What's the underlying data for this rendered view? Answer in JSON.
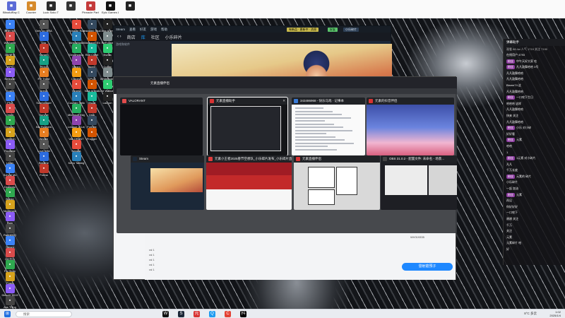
{
  "desktop": {
    "top_row": [
      {
        "label": "BlissfulRay Center",
        "icon": "app-icon",
        "color": "#5b6bd6"
      },
      {
        "label": "Counter",
        "icon": "app-icon",
        "color": "#d68a2b"
      },
      {
        "label": "Luck Soko T",
        "icon": "app-icon",
        "color": "#2b2b2b"
      },
      {
        "label": "",
        "icon": "app-icon",
        "color": "#333"
      },
      {
        "label": "Pinnacle Party",
        "icon": "app-icon",
        "color": "#c43a3a"
      },
      {
        "label": "Epic Games Launcher",
        "icon": "app-icon",
        "color": "#111"
      },
      {
        "label": "",
        "icon": "app-icon",
        "color": "#222"
      }
    ],
    "col1": [
      "腾讯TIM",
      "WeGame",
      "360安全",
      "WPS",
      "Netease",
      "Guard",
      "PN2",
      "Origin",
      "Dragon",
      "Logitech",
      "Rockstar",
      "Uplay",
      "School Mx",
      "Dragonlz",
      "Bunke",
      "Nightmare",
      "Ruin",
      "RabbitMQ",
      "Steam",
      "QQ音乐",
      "Pal Story",
      "Flash",
      "DirectX 2019",
      "Ass Thing"
    ],
    "col2": [
      "Only Up BRAINR",
      "Dig",
      "Sorgen",
      "PEAK",
      "RV There",
      "Arena",
      "Schrödinger",
      "Survive",
      "Bio Rushers",
      "Wordle",
      "Love Wild",
      "Breathe",
      "Forma"
    ],
    "col3": [
      "Pinnacle Rocket",
      "BenchMark",
      "Geophysics",
      "Steam",
      "Chrome",
      "Vegeta",
      "Counter Strike",
      "Microsoft Edge",
      "League of Legends",
      "VALORANT",
      "Naraka",
      "Keep Talking"
    ],
    "col4": [
      "Insta360 Studio",
      "Wallpaper Engine",
      "Riot Client",
      "Apex",
      "CPUZ",
      "New Arrival",
      "Visual",
      "Disk",
      "Fortnite",
      "Frogger"
    ],
    "col5": [
      "Clinic Anime",
      "ReFrame",
      "Nvidia",
      "Cultist",
      "Whiteboard",
      "Live Wallpaper",
      "Lanyon"
    ]
  },
  "steam": {
    "title": "Steam",
    "menu": [
      "Steam",
      "查看",
      "好友",
      "游戏",
      "帮助"
    ],
    "nav": [
      "商店",
      "库",
      "社区",
      "小乐碎片"
    ],
    "active_nav": "库",
    "library_label": "游戏和软件",
    "list_items": [
      "Kil Decoration Assemb...",
      "Counter-Strike 2",
      "BlissfulRay Center"
    ],
    "top_buttons": {
      "notice": "有新品 · 更新中 · 消息",
      "friends": "好友",
      "user": "小乐碎片"
    }
  },
  "taskview": {
    "cards": [
      {
        "title": "VALORANT",
        "icon_color": "#e14b4b",
        "thumb": "valorant"
      },
      {
        "title": "元素直播助手",
        "icon_color": "#d83333",
        "thumb": "douyin",
        "selected": true
      },
      {
        "title": "343486968 - 快乐马戏 · 记事本",
        "icon_color": "#3a7bd5",
        "thumb": "doc"
      },
      {
        "title": "元素的抖音伴侣",
        "icon_color": "#d83333",
        "thumb": "obs1"
      },
      {
        "title": "Steam",
        "icon_color": "#1b2838",
        "thumb": "steam2"
      },
      {
        "title": "元素小王者2025春节空想队_小乐碎片发布_小乐碎片直播...",
        "icon_color": "#e03c3c",
        "thumb": "red"
      },
      {
        "title": "元素直播伴侣",
        "icon_color": "#d83333",
        "thumb": "manga"
      },
      {
        "title": "OBS 31.0.2 - 配置文件: 未命名 - 场景...",
        "icon_color": "#444",
        "thumb": "obs2"
      }
    ]
  },
  "stream_window": {
    "tab_label": "元素直播伴侣",
    "counters": [
      "632564",
      "7955",
      "3829",
      "000",
      "70"
    ],
    "user_id": "WV019335",
    "send_button": "發射搶預子",
    "chat_prefix": "ral 1",
    "notice_text": "如果开始直播请点击按钮"
  },
  "live_chat": {
    "header": "弹幕助手",
    "stats": "观看 88.4w  人气 1719  关注 7190",
    "lines": [
      {
        "user": "在线用户",
        "text": "4793",
        "badge": ""
      },
      {
        "user": "中午天好大家 吃",
        "text": "",
        "badge": "粉丝"
      },
      {
        "user": "凡凡鼓舞哈哈",
        "text": "3号",
        "badge": "粉丝"
      },
      {
        "user": "凡凡鼓舞哈哈",
        "text": "",
        "badge": ""
      },
      {
        "user": "凡凡鼓舞哈哈",
        "text": "",
        "badge": ""
      },
      {
        "user": "Blame74 这",
        "text": "",
        "badge": ""
      },
      {
        "user": "凡凡鼓舞哈哈",
        "text": "",
        "badge": ""
      },
      {
        "user": "一口咬下生日",
        "text": "",
        "badge": "粉丝"
      },
      {
        "user": "哈哈哈 这样",
        "text": "",
        "badge": ""
      },
      {
        "user": "凡凡鼓舞哈哈",
        "text": "",
        "badge": ""
      },
      {
        "user": "快来 关注",
        "text": "",
        "badge": ""
      },
      {
        "user": "凡凡鼓舞哈哈",
        "text": "",
        "badge": ""
      },
      {
        "user": "小乐 对小碎",
        "text": "",
        "badge": "粉丝"
      },
      {
        "user": "好好看",
        "text": "",
        "badge": ""
      },
      {
        "user": "元素",
        "text": "",
        "badge": "粉丝"
      },
      {
        "user": "哈哈",
        "text": "",
        "badge": ""
      },
      {
        "user": "1",
        "text": "",
        "badge": ""
      },
      {
        "user": "1元素 对小碎片",
        "text": "",
        "badge": "粉丝"
      },
      {
        "user": "凡凡",
        "text": "",
        "badge": ""
      },
      {
        "user": "千万长度",
        "text": "",
        "badge": ""
      },
      {
        "user": "元素的 碎片",
        "text": "",
        "badge": "粉丝"
      },
      {
        "user": "小乐碎片",
        "text": "",
        "badge": ""
      },
      {
        "user": "一起 加油",
        "text": "",
        "badge": ""
      },
      {
        "user": "元素",
        "text": "",
        "badge": "粉丝"
      },
      {
        "user": "再见",
        "text": "",
        "badge": ""
      },
      {
        "user": "你好好好",
        "text": "",
        "badge": ""
      },
      {
        "user": "一口咬下",
        "text": "",
        "badge": ""
      },
      {
        "user": "谢谢 关注",
        "text": "",
        "badge": ""
      },
      {
        "user": "千万",
        "text": "",
        "badge": ""
      },
      {
        "user": "关注",
        "text": "",
        "badge": ""
      },
      {
        "user": "元素",
        "text": "",
        "badge": ""
      },
      {
        "user": "元素碎片 哈",
        "text": "",
        "badge": ""
      },
      {
        "user": "好",
        "text": "",
        "badge": ""
      }
    ]
  },
  "taskbar": {
    "search_placeholder": "搜索",
    "apps": [
      "WeGame",
      "Steam",
      "元素直播",
      "QQ",
      "Chrome",
      "抖音"
    ],
    "weather": "8°C 多云",
    "time": "1:02",
    "date": "2025/1/4",
    "colors": {
      "start": "#1f6fe0",
      "accent": "#1e88ff"
    }
  }
}
